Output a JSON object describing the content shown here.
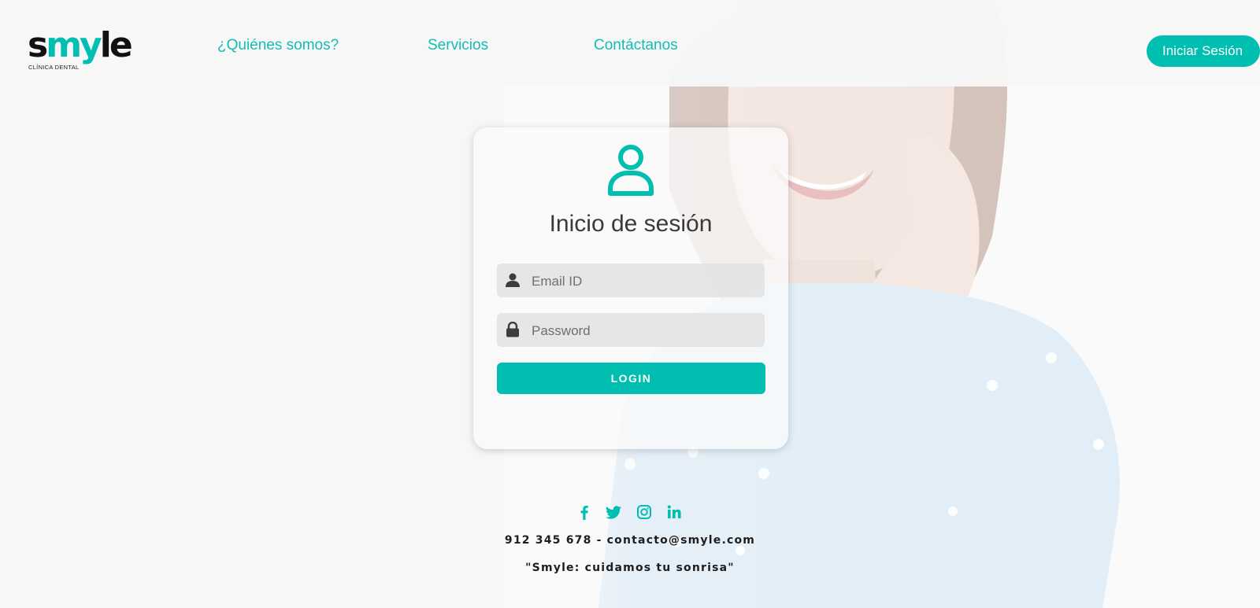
{
  "brand": {
    "logo_part1": "s",
    "logo_accent": "my",
    "logo_part2": "le",
    "logo_sub": "CLÍNICA DENTAL",
    "accent_color": "#00bfb0"
  },
  "nav": {
    "items": [
      {
        "label": "¿Quiénes somos?"
      },
      {
        "label": "Servicios"
      },
      {
        "label": "Contáctanos"
      }
    ],
    "signin_label": "Iniciar Sesión"
  },
  "login": {
    "icon": "user-icon",
    "title": "Inicio de sesión",
    "email": {
      "placeholder": "Email ID",
      "value": "",
      "icon": "person-icon"
    },
    "password": {
      "placeholder": "Password",
      "value": "",
      "icon": "lock-icon"
    },
    "button_label": "LOGIN"
  },
  "footer": {
    "social": [
      "facebook-icon",
      "twitter-icon",
      "instagram-icon",
      "linkedin-icon"
    ],
    "contact": "912 345 678 - contacto@smyle.com",
    "slogan": "\"Smyle: cuidamos tu sonrisa\""
  }
}
